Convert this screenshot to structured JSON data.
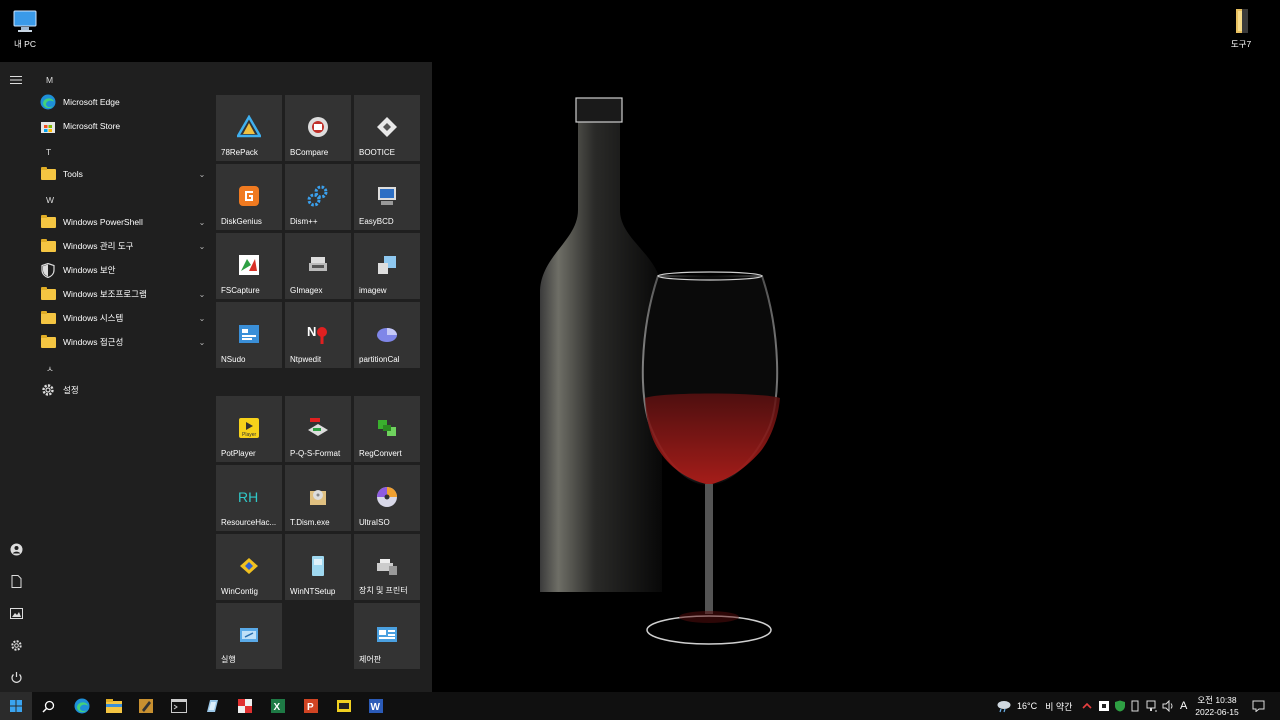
{
  "desktop": {
    "icons": [
      {
        "label": "내 PC"
      },
      {
        "label": "도구7"
      }
    ]
  },
  "start_menu": {
    "groups": [
      {
        "letter": "M",
        "items": [
          {
            "label": "Microsoft Edge",
            "expandable": false
          },
          {
            "label": "Microsoft Store",
            "expandable": false
          }
        ]
      },
      {
        "letter": "T",
        "items": [
          {
            "label": "Tools",
            "expandable": true
          }
        ]
      },
      {
        "letter": "W",
        "items": [
          {
            "label": "Windows PowerShell",
            "expandable": true
          },
          {
            "label": "Windows 관리 도구",
            "expandable": true
          },
          {
            "label": "Windows 보안",
            "expandable": false
          },
          {
            "label": "Windows 보조프로그램",
            "expandable": true
          },
          {
            "label": "Windows 시스템",
            "expandable": true
          },
          {
            "label": "Windows 접근성",
            "expandable": true
          }
        ]
      },
      {
        "letter": "ㅅ",
        "items": [
          {
            "label": "설정",
            "expandable": false
          }
        ]
      }
    ],
    "tiles_group1": [
      {
        "label": "78RePack",
        "icon": "triangle-icon"
      },
      {
        "label": "BCompare",
        "icon": "bcompare-icon"
      },
      {
        "label": "BOOTICE",
        "icon": "bootice-icon"
      },
      {
        "label": "DiskGenius",
        "icon": "diskgenius-icon"
      },
      {
        "label": "Dism++",
        "icon": "gears-icon"
      },
      {
        "label": "EasyBCD",
        "icon": "easybcd-icon"
      },
      {
        "label": "FSCapture",
        "icon": "fscapture-icon"
      },
      {
        "label": "GImagex",
        "icon": "gimagex-icon"
      },
      {
        "label": "imagew",
        "icon": "imagew-icon"
      },
      {
        "label": "NSudo",
        "icon": "nsudo-icon"
      },
      {
        "label": "Ntpwedit",
        "icon": "ntpwedit-icon"
      },
      {
        "label": "partitionCal",
        "icon": "pie-icon"
      }
    ],
    "tiles_group2": [
      {
        "label": "PotPlayer",
        "icon": "potplayer-icon"
      },
      {
        "label": "P-Q-S-Format",
        "icon": "format-icon"
      },
      {
        "label": "RegConvert",
        "icon": "regconvert-icon"
      },
      {
        "label": "ResourceHac...",
        "icon": "rh-icon"
      },
      {
        "label": "T.Dism.exe",
        "icon": "tdism-icon"
      },
      {
        "label": "UltraISO",
        "icon": "disc-icon"
      },
      {
        "label": "WinContig",
        "icon": "wincontig-icon"
      },
      {
        "label": "WinNTSetup",
        "icon": "winntsetup-icon"
      },
      {
        "label": "장치 및 프린터",
        "icon": "printer-icon"
      },
      {
        "label": "실행",
        "icon": "run-icon"
      },
      {
        "label": "제어판",
        "icon": "control-panel-icon"
      }
    ]
  },
  "taskbar": {
    "weather": {
      "temp": "16°C",
      "desc": "비 약간"
    },
    "ime": "A",
    "clock": {
      "time": "오전 10:38",
      "date": "2022-06-15"
    }
  }
}
